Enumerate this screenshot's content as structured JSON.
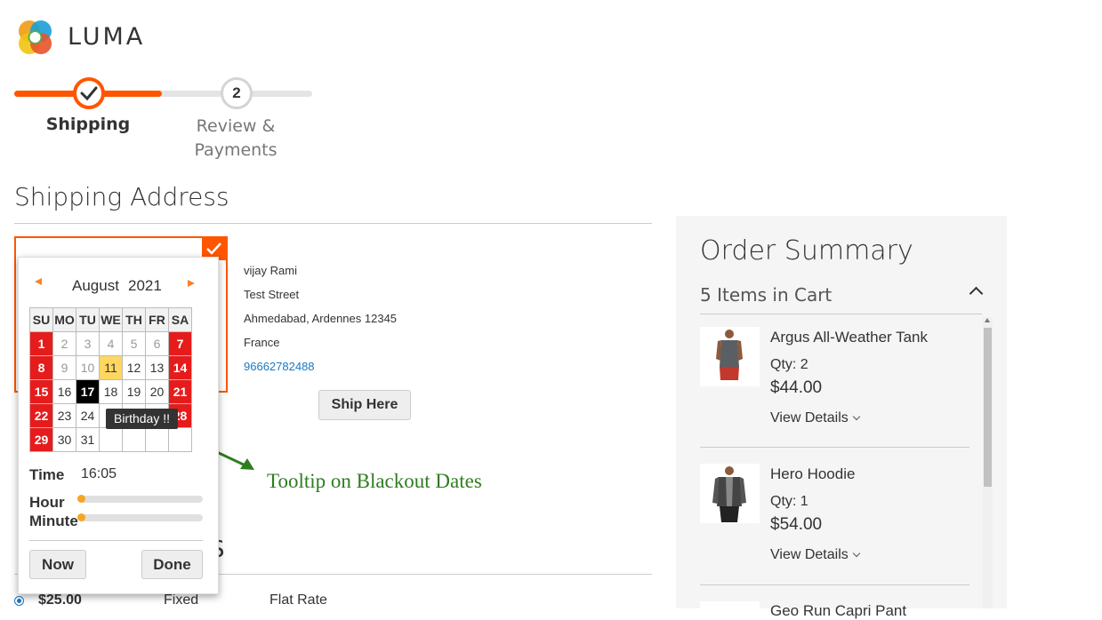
{
  "brand": {
    "name": "LUMA"
  },
  "progress": {
    "steps": [
      {
        "label": "Shipping",
        "state": "complete"
      },
      {
        "number": "2",
        "label_line1": "Review &",
        "label_line2": "Payments"
      }
    ]
  },
  "shipping": {
    "heading": "Shipping Address",
    "address": {
      "name": "vijay Rami",
      "street": "Test Street",
      "city_line": "Ahmedabad, Ardennes 12345",
      "country": "France",
      "phone": "96662782488"
    },
    "ship_here_label": "Ship Here"
  },
  "datepicker": {
    "month": "August",
    "year": "2021",
    "weekdays": [
      "SU",
      "MO",
      "TU",
      "WE",
      "TH",
      "FR",
      "SA"
    ],
    "weeks": [
      [
        "1",
        "2",
        "3",
        "4",
        "5",
        "6",
        "7"
      ],
      [
        "8",
        "9",
        "10",
        "11",
        "12",
        "13",
        "14"
      ],
      [
        "15",
        "16",
        "17",
        "18",
        "19",
        "20",
        "21"
      ],
      [
        "22",
        "23",
        "24",
        "",
        "",
        "",
        "28"
      ],
      [
        "29",
        "30",
        "31",
        "",
        "",
        "",
        ""
      ]
    ],
    "tooltip": "Birthday !!",
    "time_label": "Time",
    "time_value": "16:05",
    "hour_label": "Hour",
    "minute_label": "Minute",
    "now_label": "Now",
    "done_label": "Done"
  },
  "annotation": {
    "text": "Tooltip on Blackout Dates"
  },
  "shipping_methods": {
    "heading_visible": "S",
    "rate": {
      "price": "$25.00",
      "type": "Fixed",
      "carrier": "Flat Rate"
    }
  },
  "summary": {
    "title": "Order Summary",
    "items_count": "5 Items in Cart",
    "items": [
      {
        "name": "Argus All-Weather Tank",
        "qty": "Qty: 2",
        "price": "$44.00",
        "view": "View Details"
      },
      {
        "name": "Hero Hoodie",
        "qty": "Qty: 1",
        "price": "$54.00",
        "view": "View Details"
      },
      {
        "name": "Geo Run Capri Pant"
      }
    ]
  },
  "colors": {
    "accent": "#ff5501",
    "link": "#1979c3",
    "blackout": "#e61c1c",
    "highlight": "#ffd760",
    "annotation": "#2e7d20"
  }
}
